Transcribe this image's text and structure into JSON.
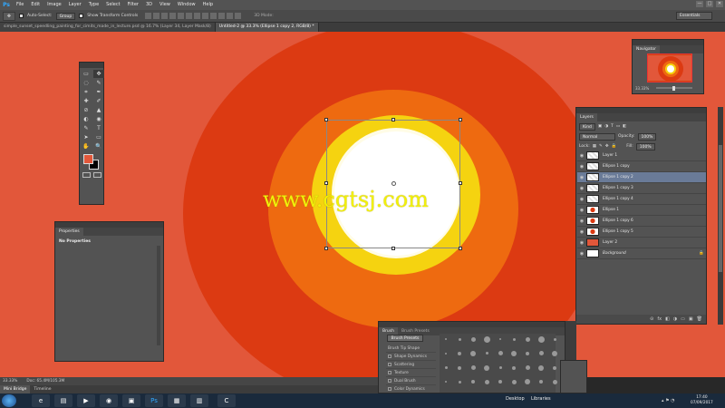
{
  "app": {
    "logo": "Ps",
    "menu": [
      "File",
      "Edit",
      "Image",
      "Layer",
      "Type",
      "Select",
      "Filter",
      "3D",
      "View",
      "Window",
      "Help"
    ],
    "window_controls": [
      "—",
      "□",
      "✕"
    ]
  },
  "options_bar": {
    "tool_icon": "move-tool-icon",
    "auto_select_label": "Auto-Select:",
    "auto_select_value": "Group",
    "show_transform_label": "Show Transform Controls",
    "mode_3d": "3D Mode:",
    "workspace": "Essentials"
  },
  "tabs": [
    {
      "label": "simple_sunset_speedling_painting_for_cimits_made_in_lecture.psd @ 16.7% (Layer 34, Layer Mask/8)",
      "active": false
    },
    {
      "label": "Untitled-2 @ 33.3% (Ellipse 1 copy 2, RGB/8) *",
      "active": true
    }
  ],
  "canvas": {
    "watermark": "www.cgtsj.com",
    "colors": {
      "bg": "#e2573a",
      "ring1": "#dc3a12",
      "ring2": "#ee6a10",
      "ring3": "#f5d310",
      "core": "#ffffff"
    }
  },
  "tools_panel": {
    "tools": [
      "▭",
      "✥",
      "◌",
      "✎",
      "⌗",
      "✒",
      "✚",
      "✐",
      "⊘",
      "▲",
      "◐",
      "◉",
      "✎",
      "T",
      "➤",
      "▭",
      "✋",
      "🔍"
    ],
    "foreground": "#e2573a",
    "background": "#000000"
  },
  "properties": {
    "tab": "Properties",
    "body": "No Properties"
  },
  "navigator": {
    "tab": "Navigator",
    "zoom": "33.33%"
  },
  "layers": {
    "tab": "Layers",
    "kind_label": "Kind",
    "blend_mode": "Normal",
    "opacity_label": "Opacity:",
    "opacity_value": "100%",
    "lock_label": "Lock:",
    "fill_label": "Fill:",
    "fill_value": "100%",
    "items": [
      {
        "name": "Layer 1",
        "thumb": "checker",
        "selected": false
      },
      {
        "name": "Ellipse 1 copy",
        "thumb": "checker",
        "selected": false
      },
      {
        "name": "Ellipse 1 copy 2",
        "thumb": "checker",
        "selected": true
      },
      {
        "name": "Ellipse 1 copy 3",
        "thumb": "checker",
        "selected": false
      },
      {
        "name": "Ellipse 1 copy 4",
        "thumb": "checker",
        "selected": false
      },
      {
        "name": "Ellipse 1",
        "thumb": "red-dot",
        "selected": false
      },
      {
        "name": "Ellipse 1 copy 6",
        "thumb": "red-dot",
        "selected": false
      },
      {
        "name": "Ellipse 1 copy 5",
        "thumb": "red-dot",
        "selected": false
      },
      {
        "name": "Layer 2",
        "thumb": "orange",
        "selected": false
      },
      {
        "name": "Background",
        "thumb": "white",
        "selected": false
      }
    ],
    "footer_icons": [
      "⊝",
      "fx",
      "◧",
      "◑",
      "▭",
      "▣",
      "🗑"
    ]
  },
  "brush": {
    "tabs": [
      "Brush",
      "Brush Presets"
    ],
    "presets_button": "Brush Presets",
    "options": [
      "Brush Tip Shape",
      "Shape Dynamics",
      "Scattering",
      "Texture",
      "Dual Brush",
      "Color Dynamics"
    ]
  },
  "status": {
    "zoom": "33.33%",
    "doc": "Doc: 65.4M/105.3M"
  },
  "bottom_tabs": [
    "Mini Bridge",
    "Timeline"
  ],
  "taskbar": {
    "desktop_label": "Desktop",
    "libraries_label": "Libraries",
    "time": "17:40",
    "date": "07/09/2017"
  }
}
